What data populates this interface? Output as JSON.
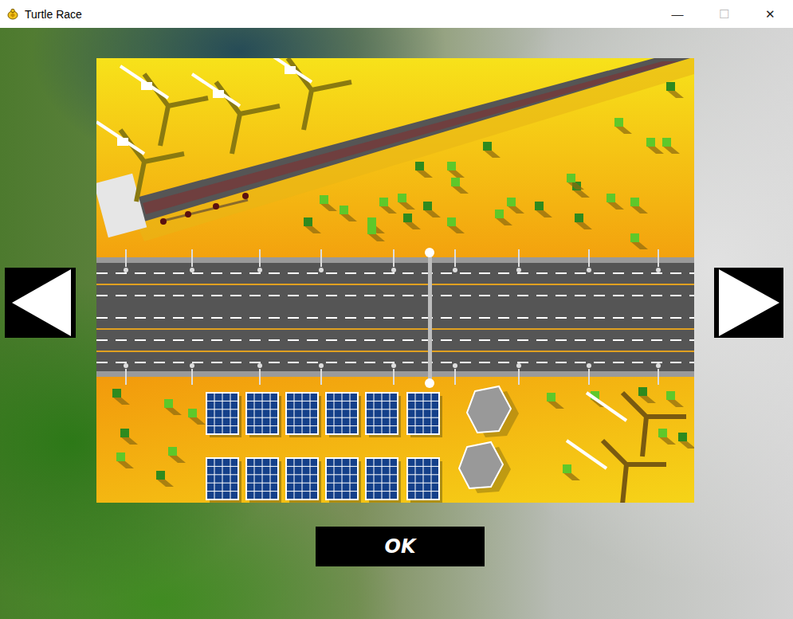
{
  "window": {
    "title": "Turtle Race",
    "controls": [
      "—",
      "☐",
      "✕"
    ]
  },
  "buttons": [
    "OK"
  ]
}
